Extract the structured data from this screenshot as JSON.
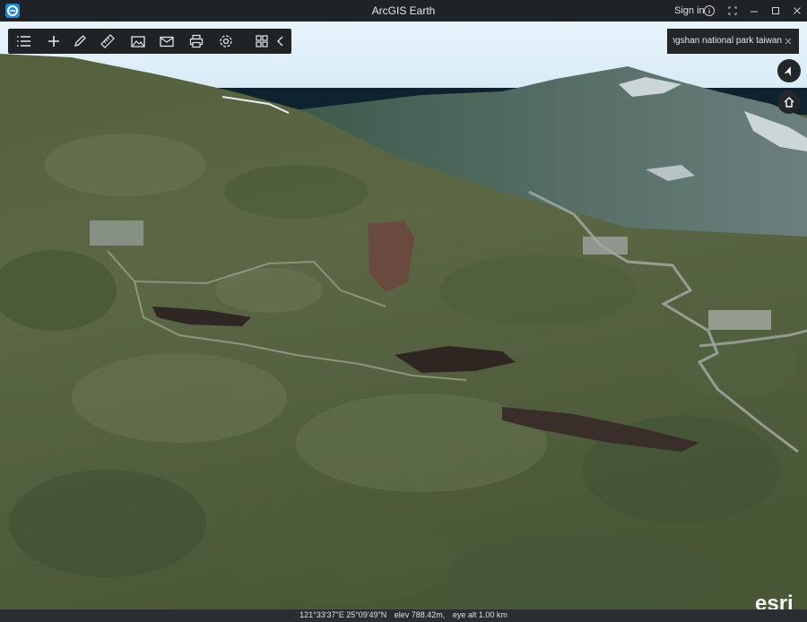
{
  "window": {
    "title": "ArcGIS Earth",
    "signin_label": "Sign in",
    "controls": [
      "info-icon",
      "fullscreen-icon",
      "minimize-icon",
      "maximize-icon",
      "close-icon"
    ]
  },
  "toolbar": {
    "tools": [
      "layers-list-icon",
      "add-icon",
      "draw-icon",
      "measure-icon",
      "image-icon",
      "mail-icon",
      "print-icon",
      "settings-icon",
      "apps-grid-icon",
      "collapse-chevron-icon"
    ]
  },
  "search": {
    "value": "angmingshan national park taiwan"
  },
  "map": {
    "compass": "compass-icon",
    "home": "home-icon",
    "attribution": "esri"
  },
  "status": {
    "coordinates": "121°33'37\"E 25°09'49\"N",
    "elevation": "elev 788.42m,",
    "eye_alt": "eye alt 1.00 km"
  }
}
